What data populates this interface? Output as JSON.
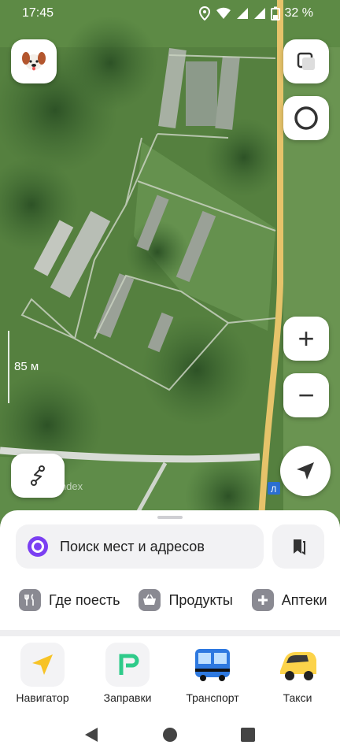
{
  "status_bar": {
    "time": "17:45",
    "battery": "32 %",
    "icons": [
      "location-icon",
      "wifi-icon",
      "signal-icon",
      "signal-icon",
      "battery-icon"
    ]
  },
  "map": {
    "scale_label": "85 м",
    "watermark": "Yandex",
    "road_sign": "Л"
  },
  "controls": {
    "zoom_in": "+",
    "zoom_out": "−"
  },
  "search": {
    "placeholder": "Поиск мест и адресов"
  },
  "categories": [
    {
      "label": "Где поесть",
      "icon": "fork-knife-icon"
    },
    {
      "label": "Продукты",
      "icon": "basket-icon"
    },
    {
      "label": "Аптеки",
      "icon": "plus-icon"
    }
  ],
  "apps": [
    {
      "label": "Навигатор",
      "icon": "navigator-arrow-icon"
    },
    {
      "label": "Заправки",
      "icon": "fuel-icon"
    },
    {
      "label": "Транспорт",
      "icon": "bus-icon"
    },
    {
      "label": "Такси",
      "icon": "taxi-icon"
    }
  ],
  "colors": {
    "accent_purple": "#7b3ff2",
    "road_yellow": "#e6c36a",
    "navigator_yellow": "#f7c326",
    "fuel_green": "#2fcb8a",
    "taxi_yellow": "#fcd34a",
    "bus_blue": "#2e79e0"
  }
}
